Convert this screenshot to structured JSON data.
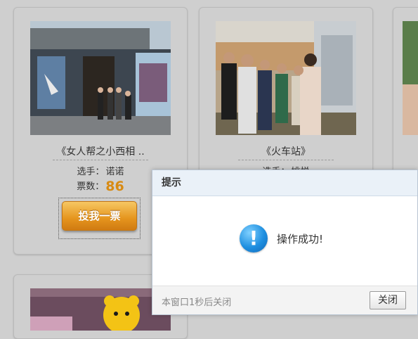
{
  "cards": [
    {
      "title": "《女人帮之小西相 ..",
      "player_label": "选手：",
      "player_name": "诺诺",
      "votes_label": "票数：",
      "votes_value": "86",
      "vote_button": "投我一票"
    },
    {
      "title": "《火车站》",
      "player_label": "选手：",
      "player_name": "姚悦"
    }
  ],
  "dialog": {
    "title": "提示",
    "message": "操作成功!",
    "icon": "info-icon",
    "auto_close_text": "本窗口1秒后关闭",
    "close_button": "关闭"
  },
  "colors": {
    "page_bg": "#cfcfcf",
    "vote_count": "#d88a12",
    "vote_button": "#e5941d",
    "info_icon": "#1e8fe0",
    "dialog_header": "#eaf1f8"
  }
}
